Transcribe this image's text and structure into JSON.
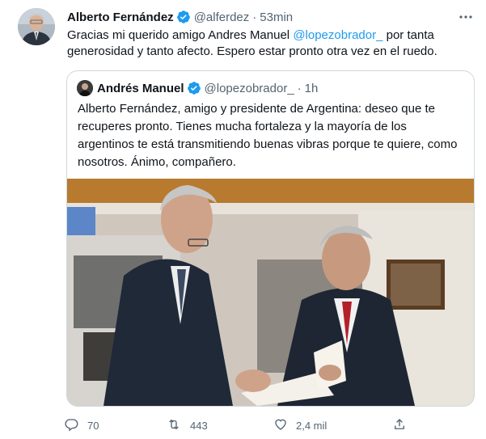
{
  "author": {
    "name": "Alberto Fernández",
    "handle": "@alferdez",
    "time": "53min",
    "separator": "·"
  },
  "tweet": {
    "text_before": "Gracias mi querido amigo Andres Manuel ",
    "mention": "@lopezobrador_",
    "text_after": " por tanta generosidad y tanto afecto. Espero estar pronto otra vez en el ruedo."
  },
  "quoted": {
    "name": "Andrés Manuel",
    "handle": "@lopezobrador_",
    "time": "1h",
    "separator": "·",
    "text": "Alberto Fernández, amigo y presidente de Argentina: deseo que te recuperes pronto. Tienes mucha fortaleza y la mayoría de los argentinos te está transmitiendo buenas vibras porque te quiere, como nosotros. Ánimo, compañero."
  },
  "actions": {
    "replies": "70",
    "retweets": "443",
    "likes": "2,4 mil"
  },
  "colors": {
    "accent": "#1d9bf0",
    "muted": "#536471",
    "border": "#cfd9de"
  },
  "icons": {
    "verified": "verified-badge-icon",
    "more": "more-dots-icon",
    "reply": "reply-icon",
    "retweet": "retweet-icon",
    "like": "heart-icon",
    "share": "share-icon"
  }
}
